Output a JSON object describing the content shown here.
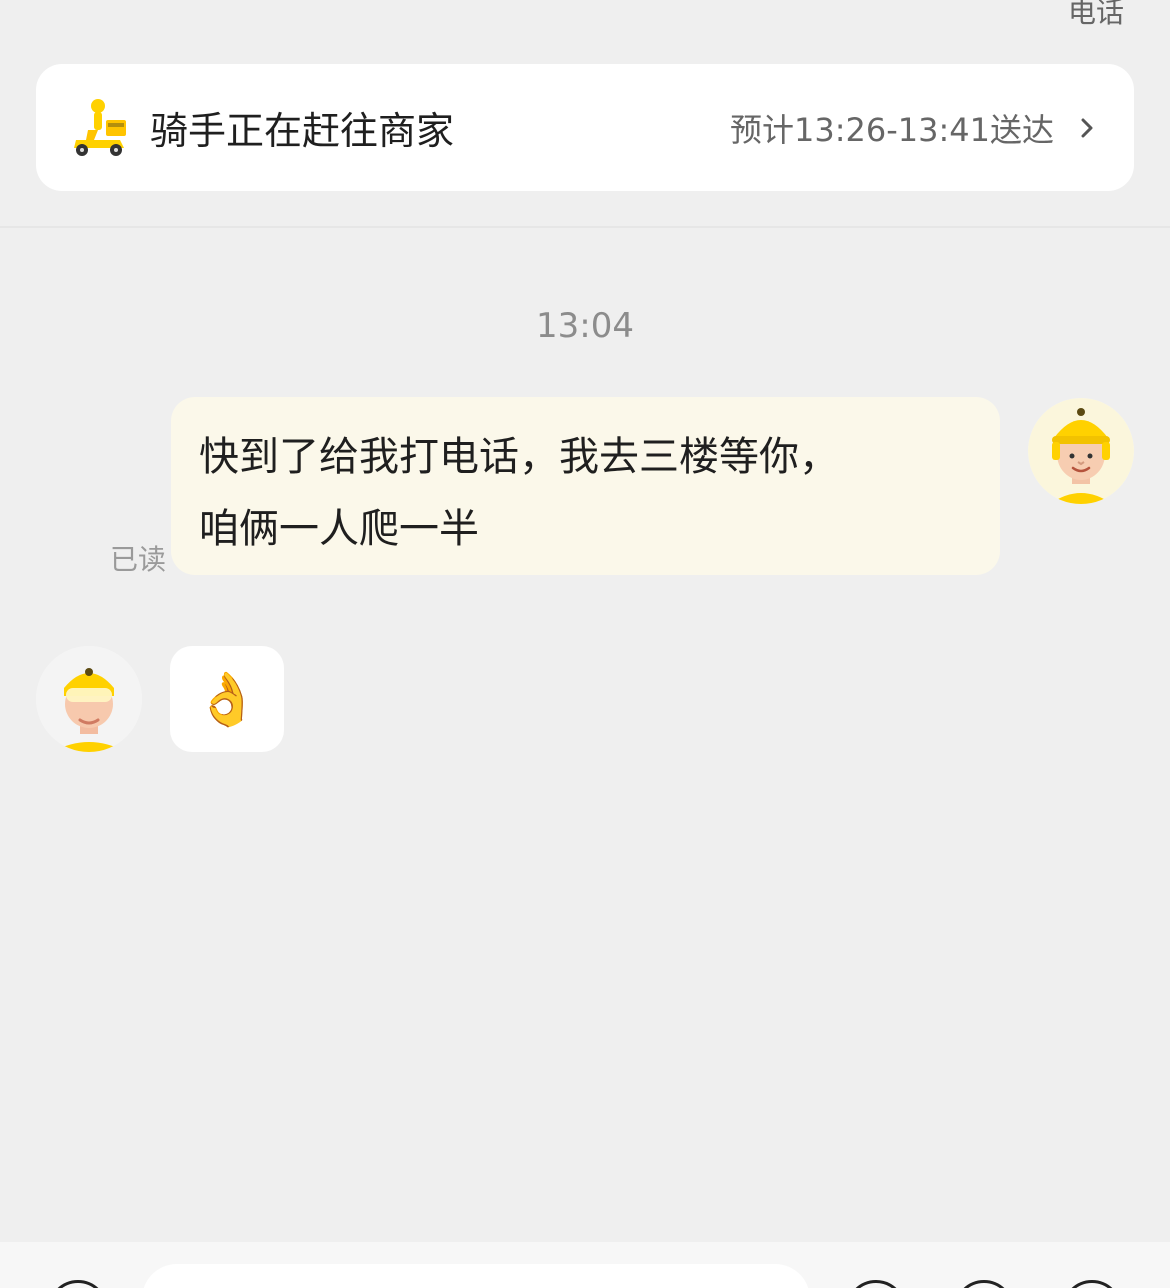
{
  "header": {
    "call_label": "电话"
  },
  "status_card": {
    "status": "骑手正在赶往商家",
    "eta": "预计13:26-13:41送达"
  },
  "chat": {
    "time_label": "13:04",
    "messages": [
      {
        "sender": "self",
        "lines": [
          "快到了给我打电话，我去三楼等你，",
          "咱俩一人爬一半"
        ],
        "read_label": "已读"
      },
      {
        "sender": "rider",
        "emoji": "👌"
      }
    ]
  },
  "icons": {
    "status_icon": "delivery-scooter-icon",
    "chevron": "chevron-right-icon"
  },
  "colors": {
    "accent": "#ffd100",
    "self_bubble": "#fbf8ea",
    "background": "#efefef"
  }
}
